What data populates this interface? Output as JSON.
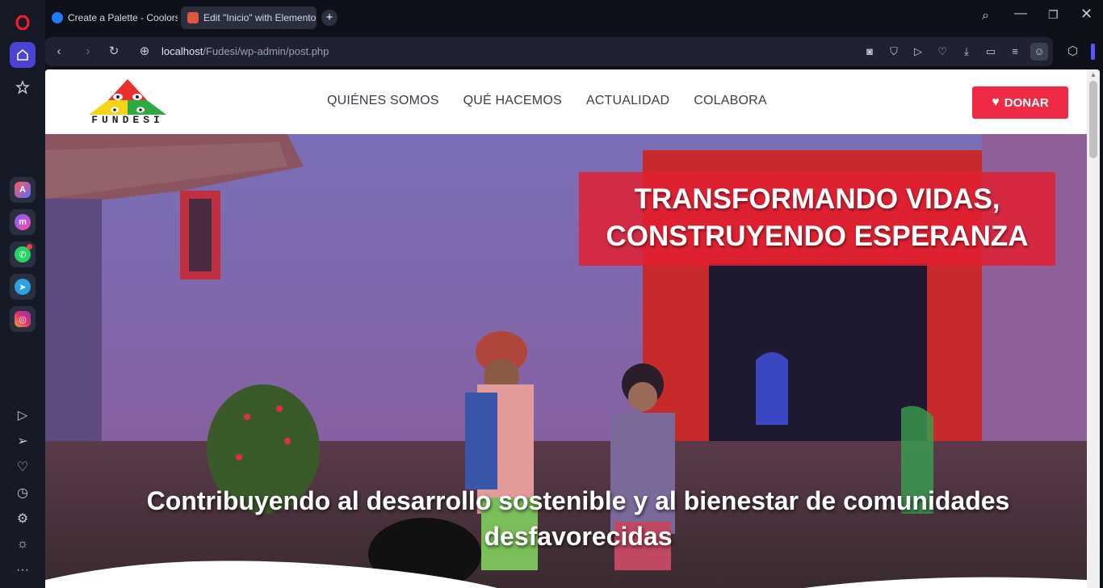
{
  "tabs": [
    {
      "title": "Create a Palette - Coolors",
      "active": false
    },
    {
      "title": "Edit \"Inicio\" with Elementor",
      "active": true
    }
  ],
  "address": {
    "host": "localhost",
    "path": "/Fudesi/wp-admin/post.php"
  },
  "site": {
    "logo_text": "FUNDESI",
    "menu": [
      "QUIÉNES SOMOS",
      "QUÉ HACEMOS",
      "ACTUALIDAD",
      "COLABORA"
    ],
    "donate_label": "DONAR"
  },
  "hero": {
    "headline_line1": "TRANSFORMANDO VIDAS,",
    "headline_line2": "CONSTRUYENDO ESPERANZA",
    "subtitle": "Contribuyendo al desarrollo sostenible y al bienestar de comunidades desfavorecidas"
  },
  "colors": {
    "accent": "#ef2a44",
    "sidebar_active": "#4b43d4"
  }
}
